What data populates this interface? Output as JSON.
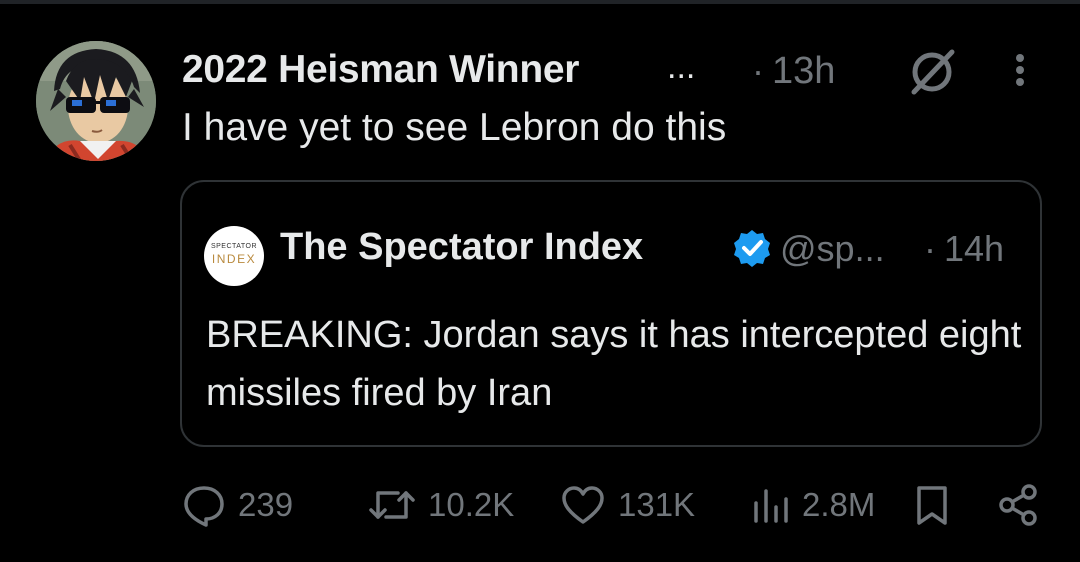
{
  "tweet": {
    "author_name": "2022 Heisman Winner",
    "name_truncation": "...",
    "separator": "·",
    "time_ago": "13h",
    "text": "I have yet to see Lebron do this",
    "avatar_icon": "anime-character-sunglasses-avatar",
    "menu_icon": "vertical-ellipsis-icon",
    "grok_icon": "grok-icon"
  },
  "quote": {
    "avatar_line1": "SPECTATOR",
    "avatar_line2": "INDEX",
    "author_name": "The Spectator Index",
    "verified_icon": "verified-badge-icon",
    "handle": "@sp...",
    "separator": "·",
    "time_ago": "14h",
    "text": "BREAKING: Jordan says it has intercepted eight missiles fired by Iran"
  },
  "actions": {
    "replies": "239",
    "reposts": "10.2K",
    "likes": "131K",
    "views": "2.8M"
  },
  "colors": {
    "background": "#000000",
    "text_primary": "#e7e9ea",
    "text_secondary": "#71767b",
    "border": "#2f3336",
    "verified_blue": "#1d9bf0",
    "brand_gold": "#b98a3e"
  }
}
